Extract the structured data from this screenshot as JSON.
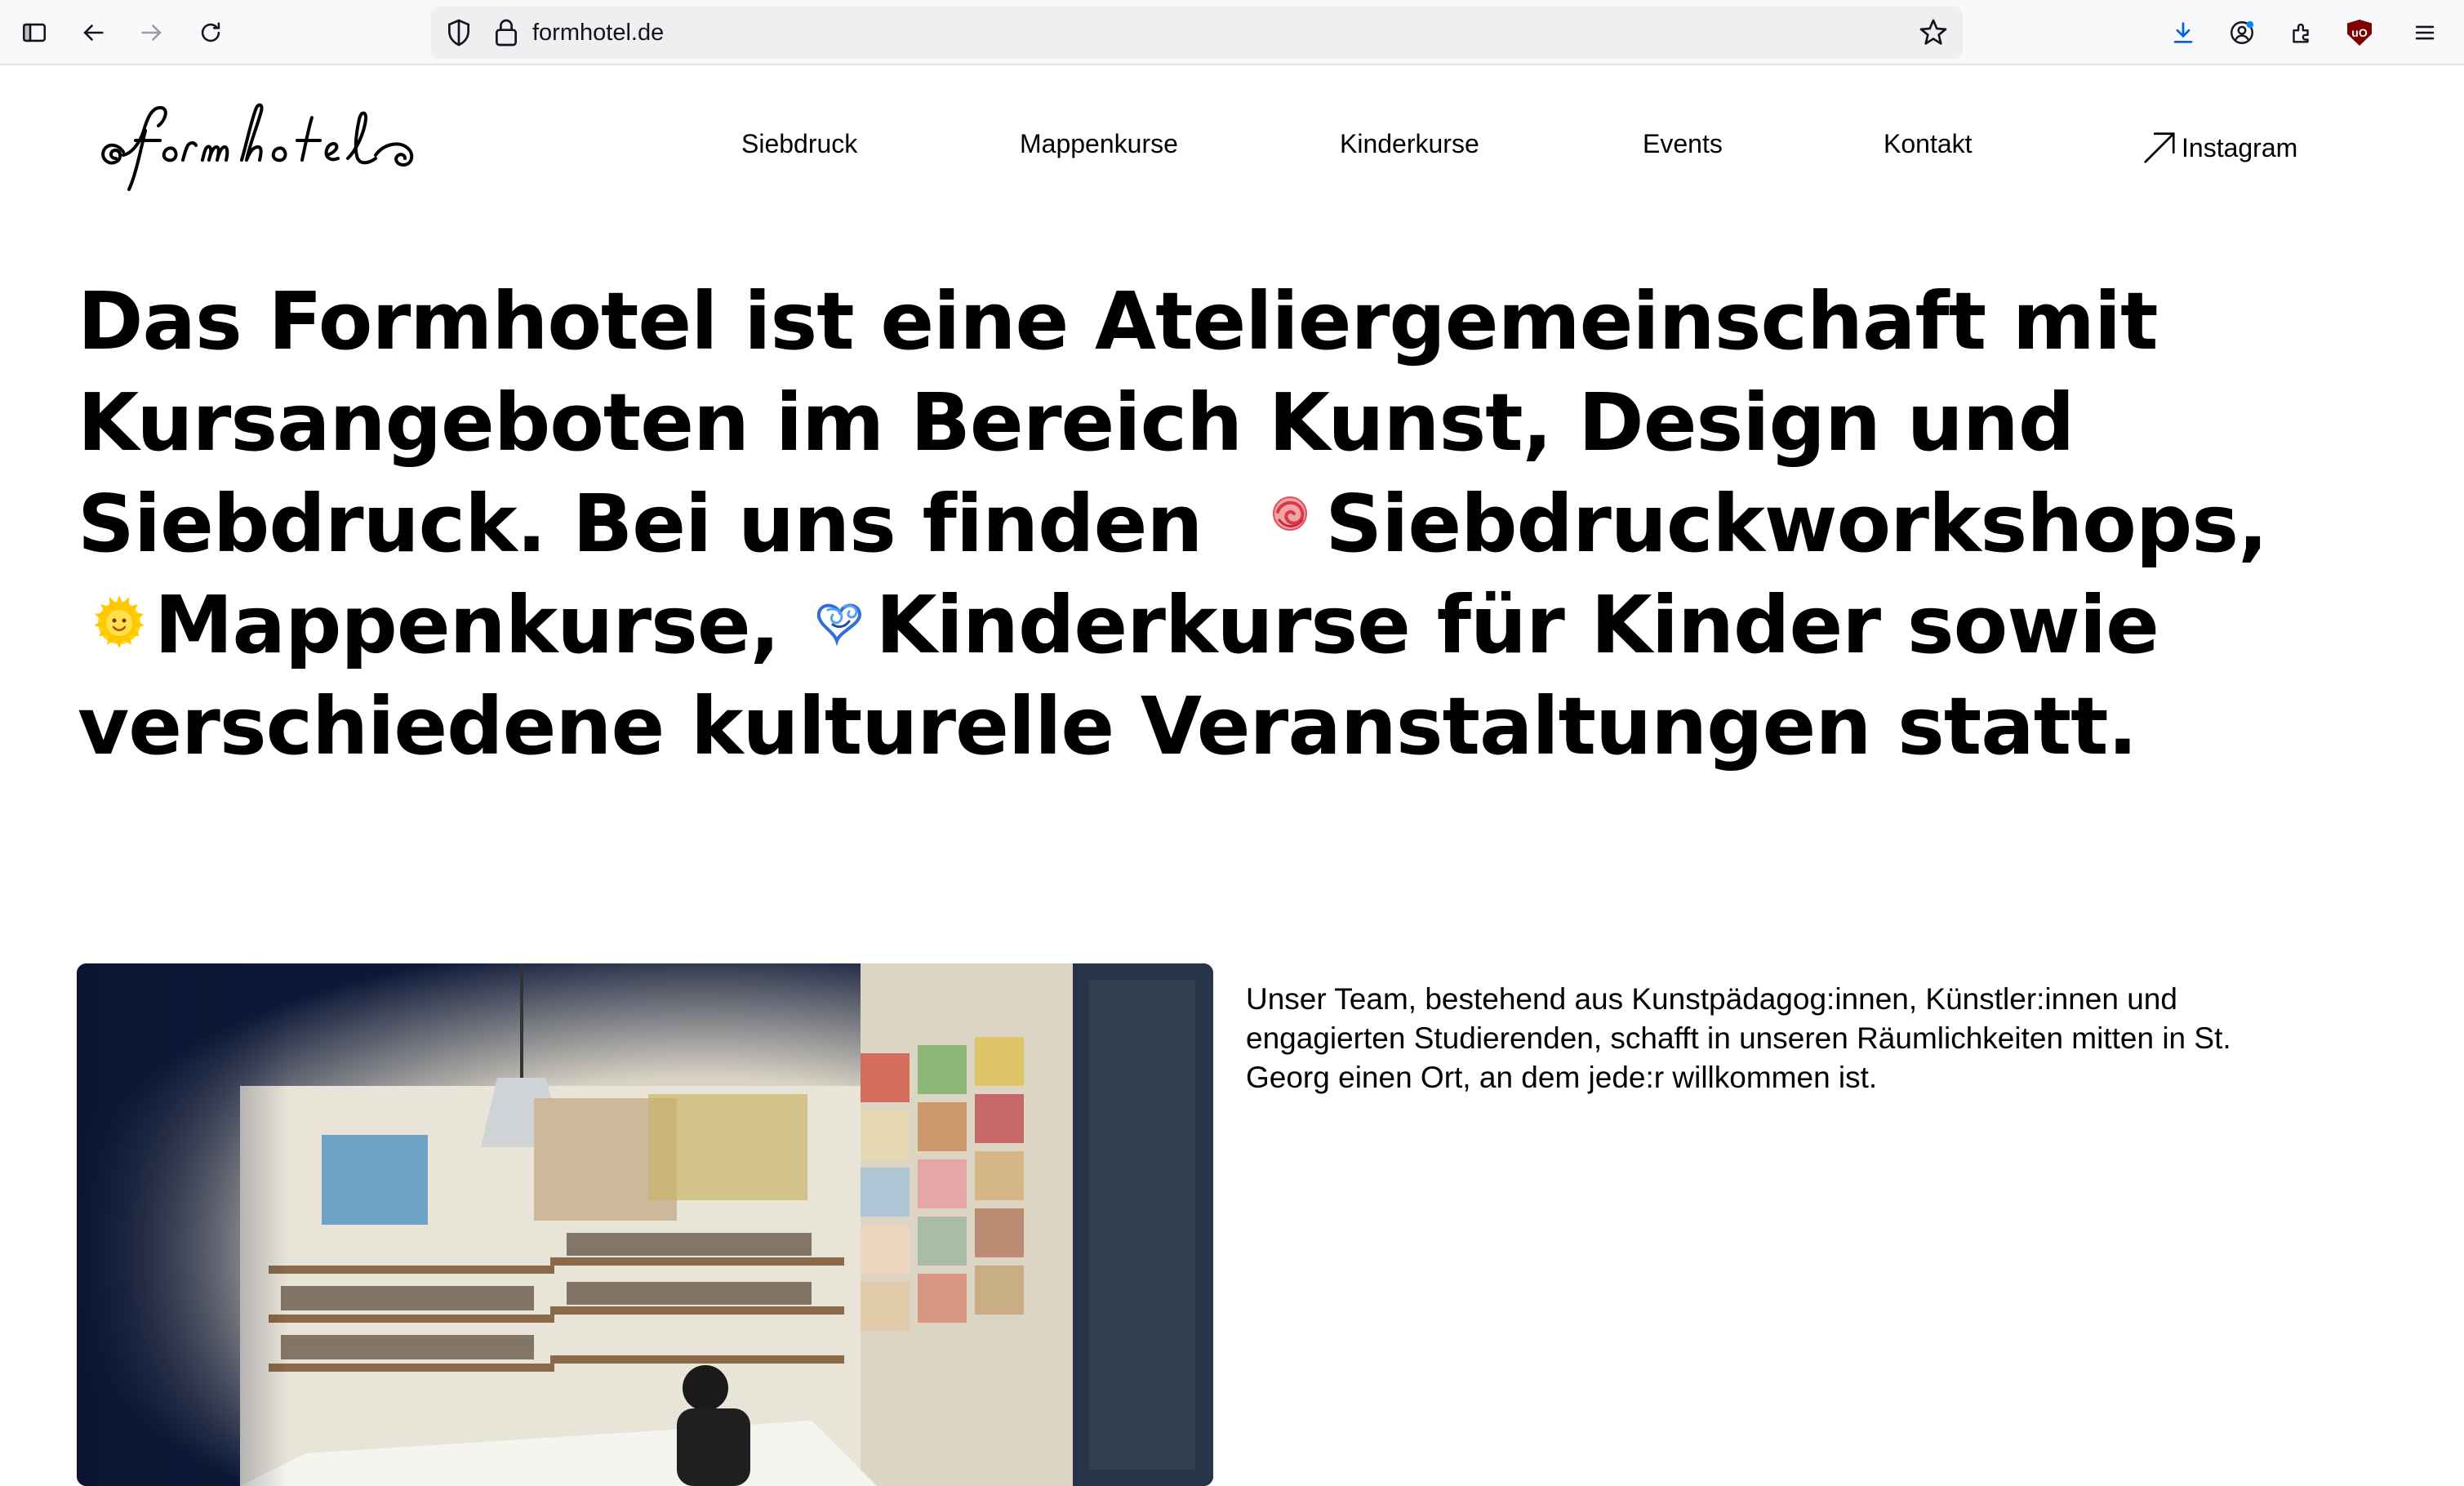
{
  "browser": {
    "url": "formhotel.de",
    "icons": [
      "sidebar-icon",
      "back-arrow-icon",
      "forward-arrow-icon",
      "reload-icon",
      "shield-icon",
      "lock-icon",
      "star-icon",
      "download-icon",
      "account-icon",
      "extensions-icon",
      "ublock-icon",
      "menu-icon"
    ],
    "ublock_badge": "uO"
  },
  "site": {
    "logo_text": "formhotel",
    "nav": [
      "Siebdruck",
      "Mappenkurse",
      "Kinderkurse",
      "Events",
      "Kontakt"
    ],
    "instagram_label": "Instagram",
    "hero": {
      "part1": "Das Formhotel ist eine Ateliergemeinschaft mit Kursangeboten im Bereich Kunst, Design und Siebdruck. Bei uns finden",
      "part2": "Siebdruckworkshops,",
      "part3": "Mappenkurse,",
      "part4": "Kinderkurse für Kinder sowie verschiedene kulturelle Veranstaltungen statt."
    },
    "intro_text": "Unser Team, bestehend aus Kunstpädagog:innen, Künstler:innen und engagierten Studierenden, schafft in unseren Räumlichkeiten mitten in St. Georg einen Ort, an dem jede:r willkommen ist."
  },
  "colors": {
    "chrome_bg": "#f9f9fb",
    "urlbar_bg": "#efeff2",
    "accent_blue": "#0060df",
    "ublock_red": "#800000",
    "text": "#000000"
  }
}
